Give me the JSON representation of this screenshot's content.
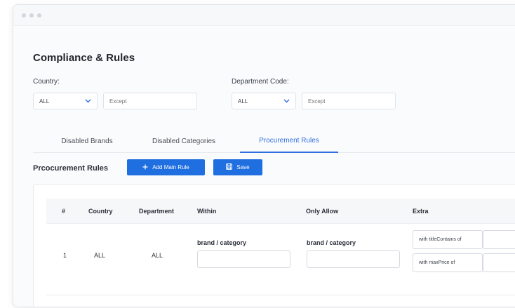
{
  "page": {
    "title": "Compliance & Rules"
  },
  "filters": {
    "country": {
      "label": "Country:",
      "value": "ALL",
      "except_placeholder": "Except"
    },
    "department": {
      "label": "Department Code:",
      "value": "ALL",
      "except_placeholder": "Except"
    }
  },
  "tabs": [
    {
      "label": "Disabled Brands"
    },
    {
      "label": "Disabled Categories"
    },
    {
      "label": "Procurement Rules"
    }
  ],
  "active_tab": "Procurement Rules",
  "section": {
    "title": "Prcocurement Rules",
    "add_main_rule_label": "Add Main Rule",
    "save_label": "Save"
  },
  "table": {
    "headers": {
      "num": "#",
      "country": "Country",
      "department": "Department",
      "within": "Within",
      "only_allow": "Only Allow",
      "extra": "Extra"
    },
    "rows": [
      {
        "num": "1",
        "country": "ALL",
        "department": "ALL",
        "within_label": "brand / category",
        "only_allow_label": "brand / category",
        "extra": [
          {
            "label": "with titleContains of"
          },
          {
            "label": "with maxPrice of"
          }
        ]
      }
    ]
  },
  "colors": {
    "accent": "#1f6fe0",
    "tab_active": "#2f6fdf"
  },
  "icons": {
    "add": "plus-icon",
    "save": "save-icon",
    "dropdown": "chevron-down-icon"
  }
}
